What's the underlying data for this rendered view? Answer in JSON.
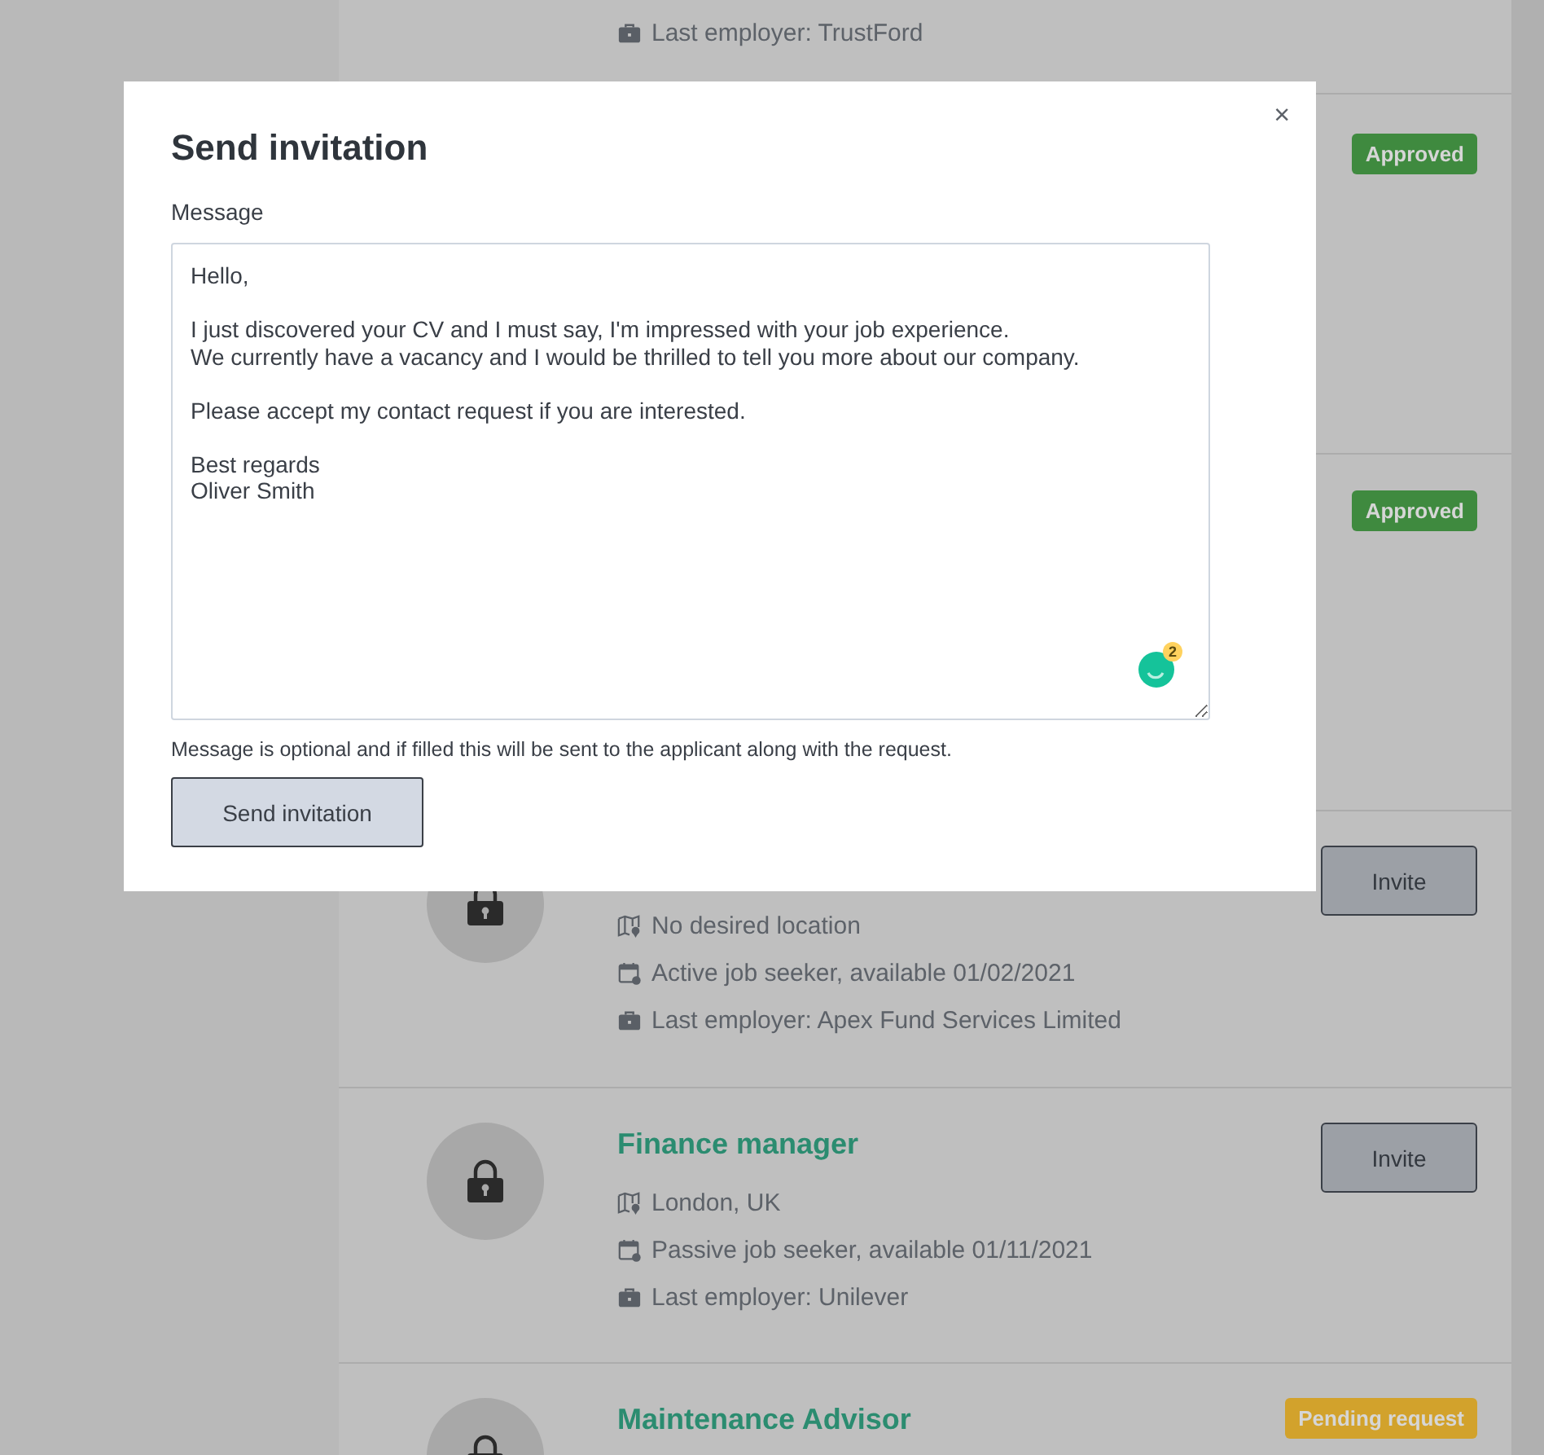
{
  "modal": {
    "title": "Send invitation",
    "close": "×",
    "message_label": "Message",
    "message": "Hello,\n\nI just discovered your CV and I must say, I'm impressed with your job experience.\nWe currently have a vacancy and I would be thrilled to tell you more about our company.\n\nPlease accept my contact request if you are interested.\n\nBest regards\nOliver Smith",
    "assistant_count": "2",
    "hint": "Message is optional and if filled this will be sent to the applicant along with the request.",
    "submit": "Send invitation"
  },
  "candidates": [
    {
      "details": [
        {
          "kind": "employer",
          "text": "Last employer: TrustFord"
        }
      ]
    },
    {
      "badge": {
        "kind": "approved",
        "label": "Approved"
      }
    },
    {
      "badge": {
        "kind": "approved",
        "label": "Approved"
      }
    },
    {
      "locked": true,
      "details": [
        {
          "kind": "location",
          "text": "No desired location"
        },
        {
          "kind": "availability",
          "text": "Active job seeker, available 01/02/2021"
        },
        {
          "kind": "employer",
          "text": "Last employer: Apex Fund Services Limited"
        }
      ],
      "action": "Invite"
    },
    {
      "locked": true,
      "title": "Finance manager",
      "details": [
        {
          "kind": "location",
          "text": "London, UK"
        },
        {
          "kind": "availability",
          "text": "Passive job seeker, available 01/11/2021"
        },
        {
          "kind": "employer",
          "text": "Last employer: Unilever"
        }
      ],
      "action": "Invite"
    },
    {
      "locked": true,
      "title": "Maintenance Advisor",
      "badge": {
        "kind": "pending",
        "label": "Pending request"
      }
    }
  ]
}
